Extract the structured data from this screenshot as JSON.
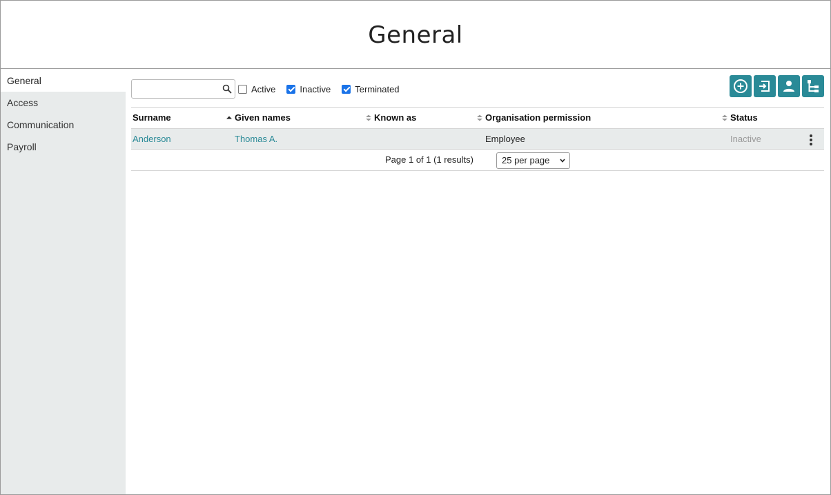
{
  "header": {
    "title": "General"
  },
  "sidebar": {
    "items": [
      {
        "label": "General",
        "active": true
      },
      {
        "label": "Access",
        "active": false
      },
      {
        "label": "Communication",
        "active": false
      },
      {
        "label": "Payroll",
        "active": false
      }
    ]
  },
  "search": {
    "value": "",
    "placeholder": "",
    "icon": "search-icon"
  },
  "filters": [
    {
      "label": "Active",
      "checked": false
    },
    {
      "label": "Inactive",
      "checked": true
    },
    {
      "label": "Terminated",
      "checked": true
    }
  ],
  "actions": [
    {
      "icon": "add-circle-icon"
    },
    {
      "icon": "import-icon"
    },
    {
      "icon": "person-icon"
    },
    {
      "icon": "hierarchy-icon"
    }
  ],
  "table": {
    "columns": [
      "Surname",
      "Given names",
      "Known as",
      "Organisation permission",
      "Status"
    ],
    "rows": [
      {
        "surname": "Anderson",
        "given_names": "Thomas A.",
        "known_as": "",
        "permission": "Employee",
        "status": "Inactive"
      }
    ]
  },
  "pagination": {
    "info": "Page 1 of 1 (1 results)",
    "per_page": "25 per page"
  },
  "colors": {
    "accent": "#2a8a97",
    "sidebar_bg": "#e8ebeb",
    "checkbox": "#1a73e8",
    "muted": "#9a9a9a"
  }
}
